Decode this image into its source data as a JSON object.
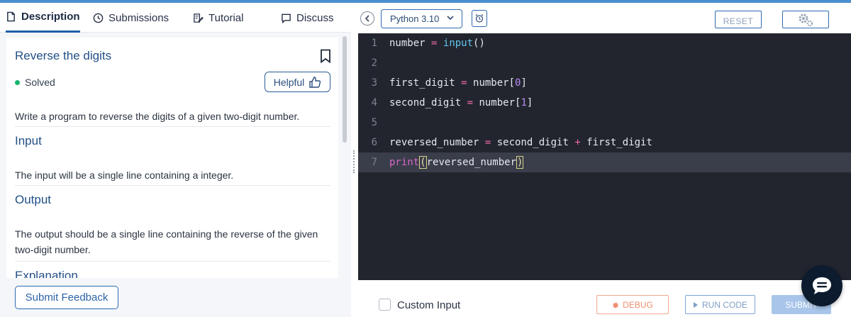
{
  "tabs": [
    {
      "label": "Description",
      "icon": "document-icon",
      "active": true
    },
    {
      "label": "Submissions",
      "icon": "clock-icon"
    },
    {
      "label": "Tutorial",
      "icon": "edit-doc-icon"
    },
    {
      "label": "Discuss",
      "icon": "chat-bubble-icon"
    }
  ],
  "question": {
    "title": "Reverse the digits",
    "status": "Solved",
    "helpful_label": "Helpful",
    "description": "Write a program to reverse the digits of a given two-digit number.",
    "input_heading": "Input",
    "input_text": "The input will be a single line containing a integer.",
    "output_heading": "Output",
    "output_text_1": "The output should be a single line containing the reverse of the given",
    "output_text_2": "two-digit number.",
    "explanation_heading": "Explanation"
  },
  "feedback_label": "Submit Feedback",
  "toolbar": {
    "language": "Python 3.10",
    "reset_label": "RESET"
  },
  "editor": {
    "line_numbers": [
      "1",
      "2",
      "3",
      "4",
      "5",
      "6",
      "7"
    ],
    "current_line": 7
  },
  "footer": {
    "custom_input_label": "Custom Input",
    "debug_label": "DEBUG",
    "run_label": "RUN CODE",
    "submit_label": "SUBMIT"
  },
  "colors": {
    "accent": "#2f6bb0",
    "editor_bg": "#22252e",
    "solved_dot": "#16b46c",
    "debug": "#ef8e6e"
  }
}
